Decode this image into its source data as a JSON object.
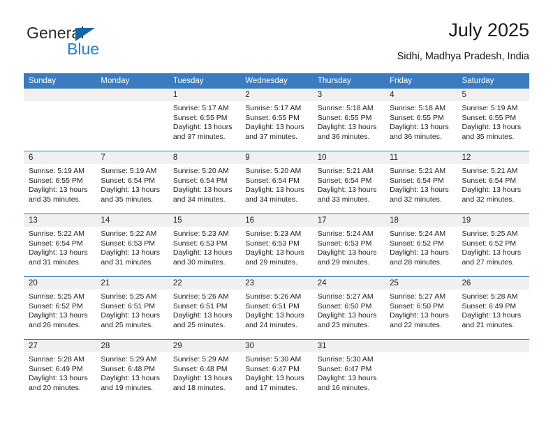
{
  "brand": {
    "name_top": "General",
    "name_bottom": "Blue",
    "triangle_color": "#1565ab",
    "blue_color": "#1f82d0"
  },
  "header": {
    "title": "July 2025",
    "location": "Sidhi, Madhya Pradesh, India"
  },
  "theme": {
    "header_blue": "#3b7cc1",
    "daynum_bg": "#f0f0f0",
    "text": "#222222"
  },
  "calendar": {
    "weekday_headers": [
      "Sunday",
      "Monday",
      "Tuesday",
      "Wednesday",
      "Thursday",
      "Friday",
      "Saturday"
    ],
    "labels": {
      "sunrise": "Sunrise:",
      "sunset": "Sunset:",
      "daylight": "Daylight:"
    },
    "weeks": [
      [
        {
          "day": "",
          "blank": true
        },
        {
          "day": "",
          "blank": true
        },
        {
          "day": "1",
          "sunrise": "Sunrise: 5:17 AM",
          "sunset": "Sunset: 6:55 PM",
          "daylight_1": "Daylight: 13 hours",
          "daylight_2": "and 37 minutes."
        },
        {
          "day": "2",
          "sunrise": "Sunrise: 5:17 AM",
          "sunset": "Sunset: 6:55 PM",
          "daylight_1": "Daylight: 13 hours",
          "daylight_2": "and 37 minutes."
        },
        {
          "day": "3",
          "sunrise": "Sunrise: 5:18 AM",
          "sunset": "Sunset: 6:55 PM",
          "daylight_1": "Daylight: 13 hours",
          "daylight_2": "and 36 minutes."
        },
        {
          "day": "4",
          "sunrise": "Sunrise: 5:18 AM",
          "sunset": "Sunset: 6:55 PM",
          "daylight_1": "Daylight: 13 hours",
          "daylight_2": "and 36 minutes."
        },
        {
          "day": "5",
          "sunrise": "Sunrise: 5:19 AM",
          "sunset": "Sunset: 6:55 PM",
          "daylight_1": "Daylight: 13 hours",
          "daylight_2": "and 35 minutes."
        }
      ],
      [
        {
          "day": "6",
          "sunrise": "Sunrise: 5:19 AM",
          "sunset": "Sunset: 6:55 PM",
          "daylight_1": "Daylight: 13 hours",
          "daylight_2": "and 35 minutes."
        },
        {
          "day": "7",
          "sunrise": "Sunrise: 5:19 AM",
          "sunset": "Sunset: 6:54 PM",
          "daylight_1": "Daylight: 13 hours",
          "daylight_2": "and 35 minutes."
        },
        {
          "day": "8",
          "sunrise": "Sunrise: 5:20 AM",
          "sunset": "Sunset: 6:54 PM",
          "daylight_1": "Daylight: 13 hours",
          "daylight_2": "and 34 minutes."
        },
        {
          "day": "9",
          "sunrise": "Sunrise: 5:20 AM",
          "sunset": "Sunset: 6:54 PM",
          "daylight_1": "Daylight: 13 hours",
          "daylight_2": "and 34 minutes."
        },
        {
          "day": "10",
          "sunrise": "Sunrise: 5:21 AM",
          "sunset": "Sunset: 6:54 PM",
          "daylight_1": "Daylight: 13 hours",
          "daylight_2": "and 33 minutes."
        },
        {
          "day": "11",
          "sunrise": "Sunrise: 5:21 AM",
          "sunset": "Sunset: 6:54 PM",
          "daylight_1": "Daylight: 13 hours",
          "daylight_2": "and 32 minutes."
        },
        {
          "day": "12",
          "sunrise": "Sunrise: 5:21 AM",
          "sunset": "Sunset: 6:54 PM",
          "daylight_1": "Daylight: 13 hours",
          "daylight_2": "and 32 minutes."
        }
      ],
      [
        {
          "day": "13",
          "sunrise": "Sunrise: 5:22 AM",
          "sunset": "Sunset: 6:54 PM",
          "daylight_1": "Daylight: 13 hours",
          "daylight_2": "and 31 minutes."
        },
        {
          "day": "14",
          "sunrise": "Sunrise: 5:22 AM",
          "sunset": "Sunset: 6:53 PM",
          "daylight_1": "Daylight: 13 hours",
          "daylight_2": "and 31 minutes."
        },
        {
          "day": "15",
          "sunrise": "Sunrise: 5:23 AM",
          "sunset": "Sunset: 6:53 PM",
          "daylight_1": "Daylight: 13 hours",
          "daylight_2": "and 30 minutes."
        },
        {
          "day": "16",
          "sunrise": "Sunrise: 5:23 AM",
          "sunset": "Sunset: 6:53 PM",
          "daylight_1": "Daylight: 13 hours",
          "daylight_2": "and 29 minutes."
        },
        {
          "day": "17",
          "sunrise": "Sunrise: 5:24 AM",
          "sunset": "Sunset: 6:53 PM",
          "daylight_1": "Daylight: 13 hours",
          "daylight_2": "and 29 minutes."
        },
        {
          "day": "18",
          "sunrise": "Sunrise: 5:24 AM",
          "sunset": "Sunset: 6:52 PM",
          "daylight_1": "Daylight: 13 hours",
          "daylight_2": "and 28 minutes."
        },
        {
          "day": "19",
          "sunrise": "Sunrise: 5:25 AM",
          "sunset": "Sunset: 6:52 PM",
          "daylight_1": "Daylight: 13 hours",
          "daylight_2": "and 27 minutes."
        }
      ],
      [
        {
          "day": "20",
          "sunrise": "Sunrise: 5:25 AM",
          "sunset": "Sunset: 6:52 PM",
          "daylight_1": "Daylight: 13 hours",
          "daylight_2": "and 26 minutes."
        },
        {
          "day": "21",
          "sunrise": "Sunrise: 5:25 AM",
          "sunset": "Sunset: 6:51 PM",
          "daylight_1": "Daylight: 13 hours",
          "daylight_2": "and 25 minutes."
        },
        {
          "day": "22",
          "sunrise": "Sunrise: 5:26 AM",
          "sunset": "Sunset: 6:51 PM",
          "daylight_1": "Daylight: 13 hours",
          "daylight_2": "and 25 minutes."
        },
        {
          "day": "23",
          "sunrise": "Sunrise: 5:26 AM",
          "sunset": "Sunset: 6:51 PM",
          "daylight_1": "Daylight: 13 hours",
          "daylight_2": "and 24 minutes."
        },
        {
          "day": "24",
          "sunrise": "Sunrise: 5:27 AM",
          "sunset": "Sunset: 6:50 PM",
          "daylight_1": "Daylight: 13 hours",
          "daylight_2": "and 23 minutes."
        },
        {
          "day": "25",
          "sunrise": "Sunrise: 5:27 AM",
          "sunset": "Sunset: 6:50 PM",
          "daylight_1": "Daylight: 13 hours",
          "daylight_2": "and 22 minutes."
        },
        {
          "day": "26",
          "sunrise": "Sunrise: 5:28 AM",
          "sunset": "Sunset: 6:49 PM",
          "daylight_1": "Daylight: 13 hours",
          "daylight_2": "and 21 minutes."
        }
      ],
      [
        {
          "day": "27",
          "sunrise": "Sunrise: 5:28 AM",
          "sunset": "Sunset: 6:49 PM",
          "daylight_1": "Daylight: 13 hours",
          "daylight_2": "and 20 minutes."
        },
        {
          "day": "28",
          "sunrise": "Sunrise: 5:29 AM",
          "sunset": "Sunset: 6:48 PM",
          "daylight_1": "Daylight: 13 hours",
          "daylight_2": "and 19 minutes."
        },
        {
          "day": "29",
          "sunrise": "Sunrise: 5:29 AM",
          "sunset": "Sunset: 6:48 PM",
          "daylight_1": "Daylight: 13 hours",
          "daylight_2": "and 18 minutes."
        },
        {
          "day": "30",
          "sunrise": "Sunrise: 5:30 AM",
          "sunset": "Sunset: 6:47 PM",
          "daylight_1": "Daylight: 13 hours",
          "daylight_2": "and 17 minutes."
        },
        {
          "day": "31",
          "sunrise": "Sunrise: 5:30 AM",
          "sunset": "Sunset: 6:47 PM",
          "daylight_1": "Daylight: 13 hours",
          "daylight_2": "and 16 minutes."
        },
        {
          "day": "",
          "blank": true
        },
        {
          "day": "",
          "blank": true
        }
      ]
    ]
  }
}
